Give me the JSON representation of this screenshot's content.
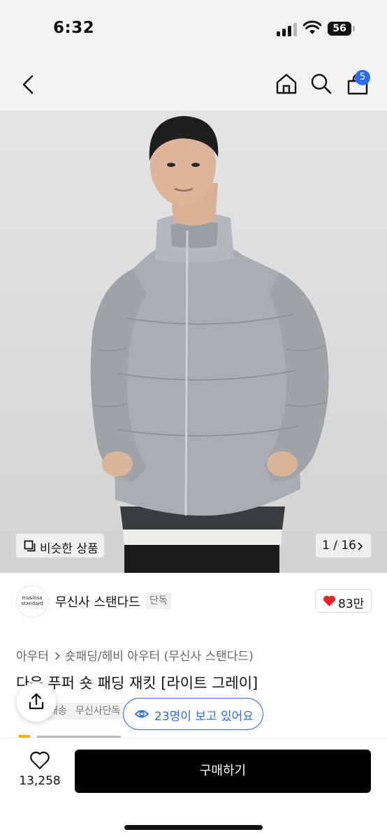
{
  "status_bar": {
    "time": "6:32",
    "battery": "56"
  },
  "nav": {
    "cart_count": "5"
  },
  "gallery": {
    "similar_label": "비슷한 상품",
    "counter": "1 / 16"
  },
  "brand": {
    "logo_line1": "musinsa",
    "logo_line2": "standard",
    "name": "무신사 스탠다드",
    "tag": "단독",
    "likes": "83만"
  },
  "breadcrumb": {
    "items": [
      "아우터",
      "숏패딩/헤비 아우터 (무신사 스탠다드)"
    ]
  },
  "product": {
    "title": "다운 푸퍼 숏 패딩 재킷 [라이트 그레이]",
    "tags": [
      "배송",
      "무신사단독"
    ]
  },
  "viewers": {
    "label": "23명이 보고 있어요"
  },
  "bottom": {
    "wishlist_count": "13,258",
    "buy_label": "구매하기"
  },
  "colors": {
    "accent_blue": "#2f69e8",
    "badge_blue": "#2a6cf0",
    "like_red": "#e8232b"
  }
}
